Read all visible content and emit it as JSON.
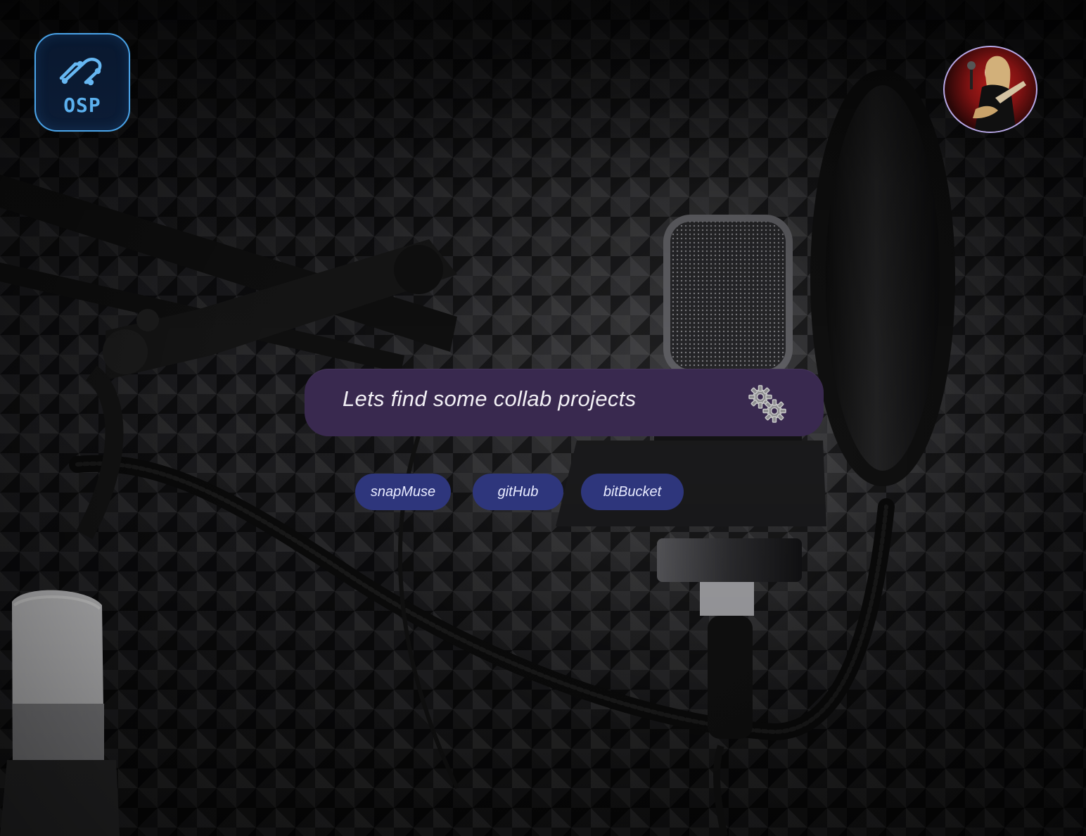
{
  "logo": {
    "text": "OSP"
  },
  "search": {
    "prompt": "Lets find some collab projects"
  },
  "icons": {
    "settings": "gears-icon",
    "avatar": "user-avatar"
  },
  "platforms": [
    {
      "label": "snapMuse"
    },
    {
      "label": "gitHub"
    },
    {
      "label": "bitBucket"
    }
  ],
  "colors": {
    "logo_border": "#4aa3e8",
    "search_background": "#39294f",
    "chip_background": "#2e367c"
  }
}
